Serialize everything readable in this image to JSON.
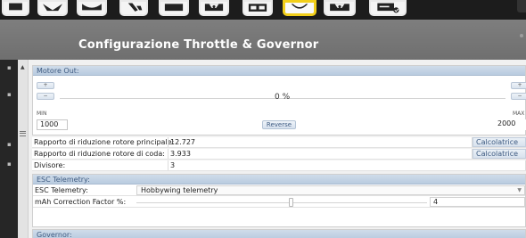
{
  "page_title": "Configurazione Throttle & Governor",
  "motore": {
    "header": "Motore Out:",
    "percent": "0 %",
    "min_label": "MIN",
    "max_label": "MAX",
    "min_value": "1000",
    "max_value": "2000",
    "reverse_label": "Reverse",
    "plus_label": "+",
    "minus_label": "−",
    "output_percent": 0
  },
  "ratios": [
    {
      "label": "Rapporto di riduzione rotore principale:",
      "value": "12.727",
      "button": "Calcolatrice ..."
    },
    {
      "label": "Rapporto di riduzione rotore di coda:",
      "value": "3.933",
      "button": "Calcolatrice ..."
    },
    {
      "label": "Divisore:",
      "value": "3"
    }
  ],
  "esc": {
    "header": "ESC Telemetry:",
    "telemetry_label": "ESC Telemetry:",
    "telemetry_value": "Hobbywing telemetry",
    "mah_label": "mAh Correction Factor %:",
    "mah_value": "4"
  },
  "governor": {
    "header": "Governor:"
  },
  "icons": [
    "toolbar-icon-1",
    "plane-icon",
    "heli-icon",
    "tail-icon",
    "swash-icon",
    "motor-icon",
    "layout-icon",
    "throttle-icon",
    "servo-icon",
    "settings-check-icon"
  ],
  "colors": {
    "toolbar_bg": "#1c1c1c",
    "active_border": "#f2cf1a",
    "titlebar_bg": "#757575",
    "header_text": "#3d5a80"
  }
}
